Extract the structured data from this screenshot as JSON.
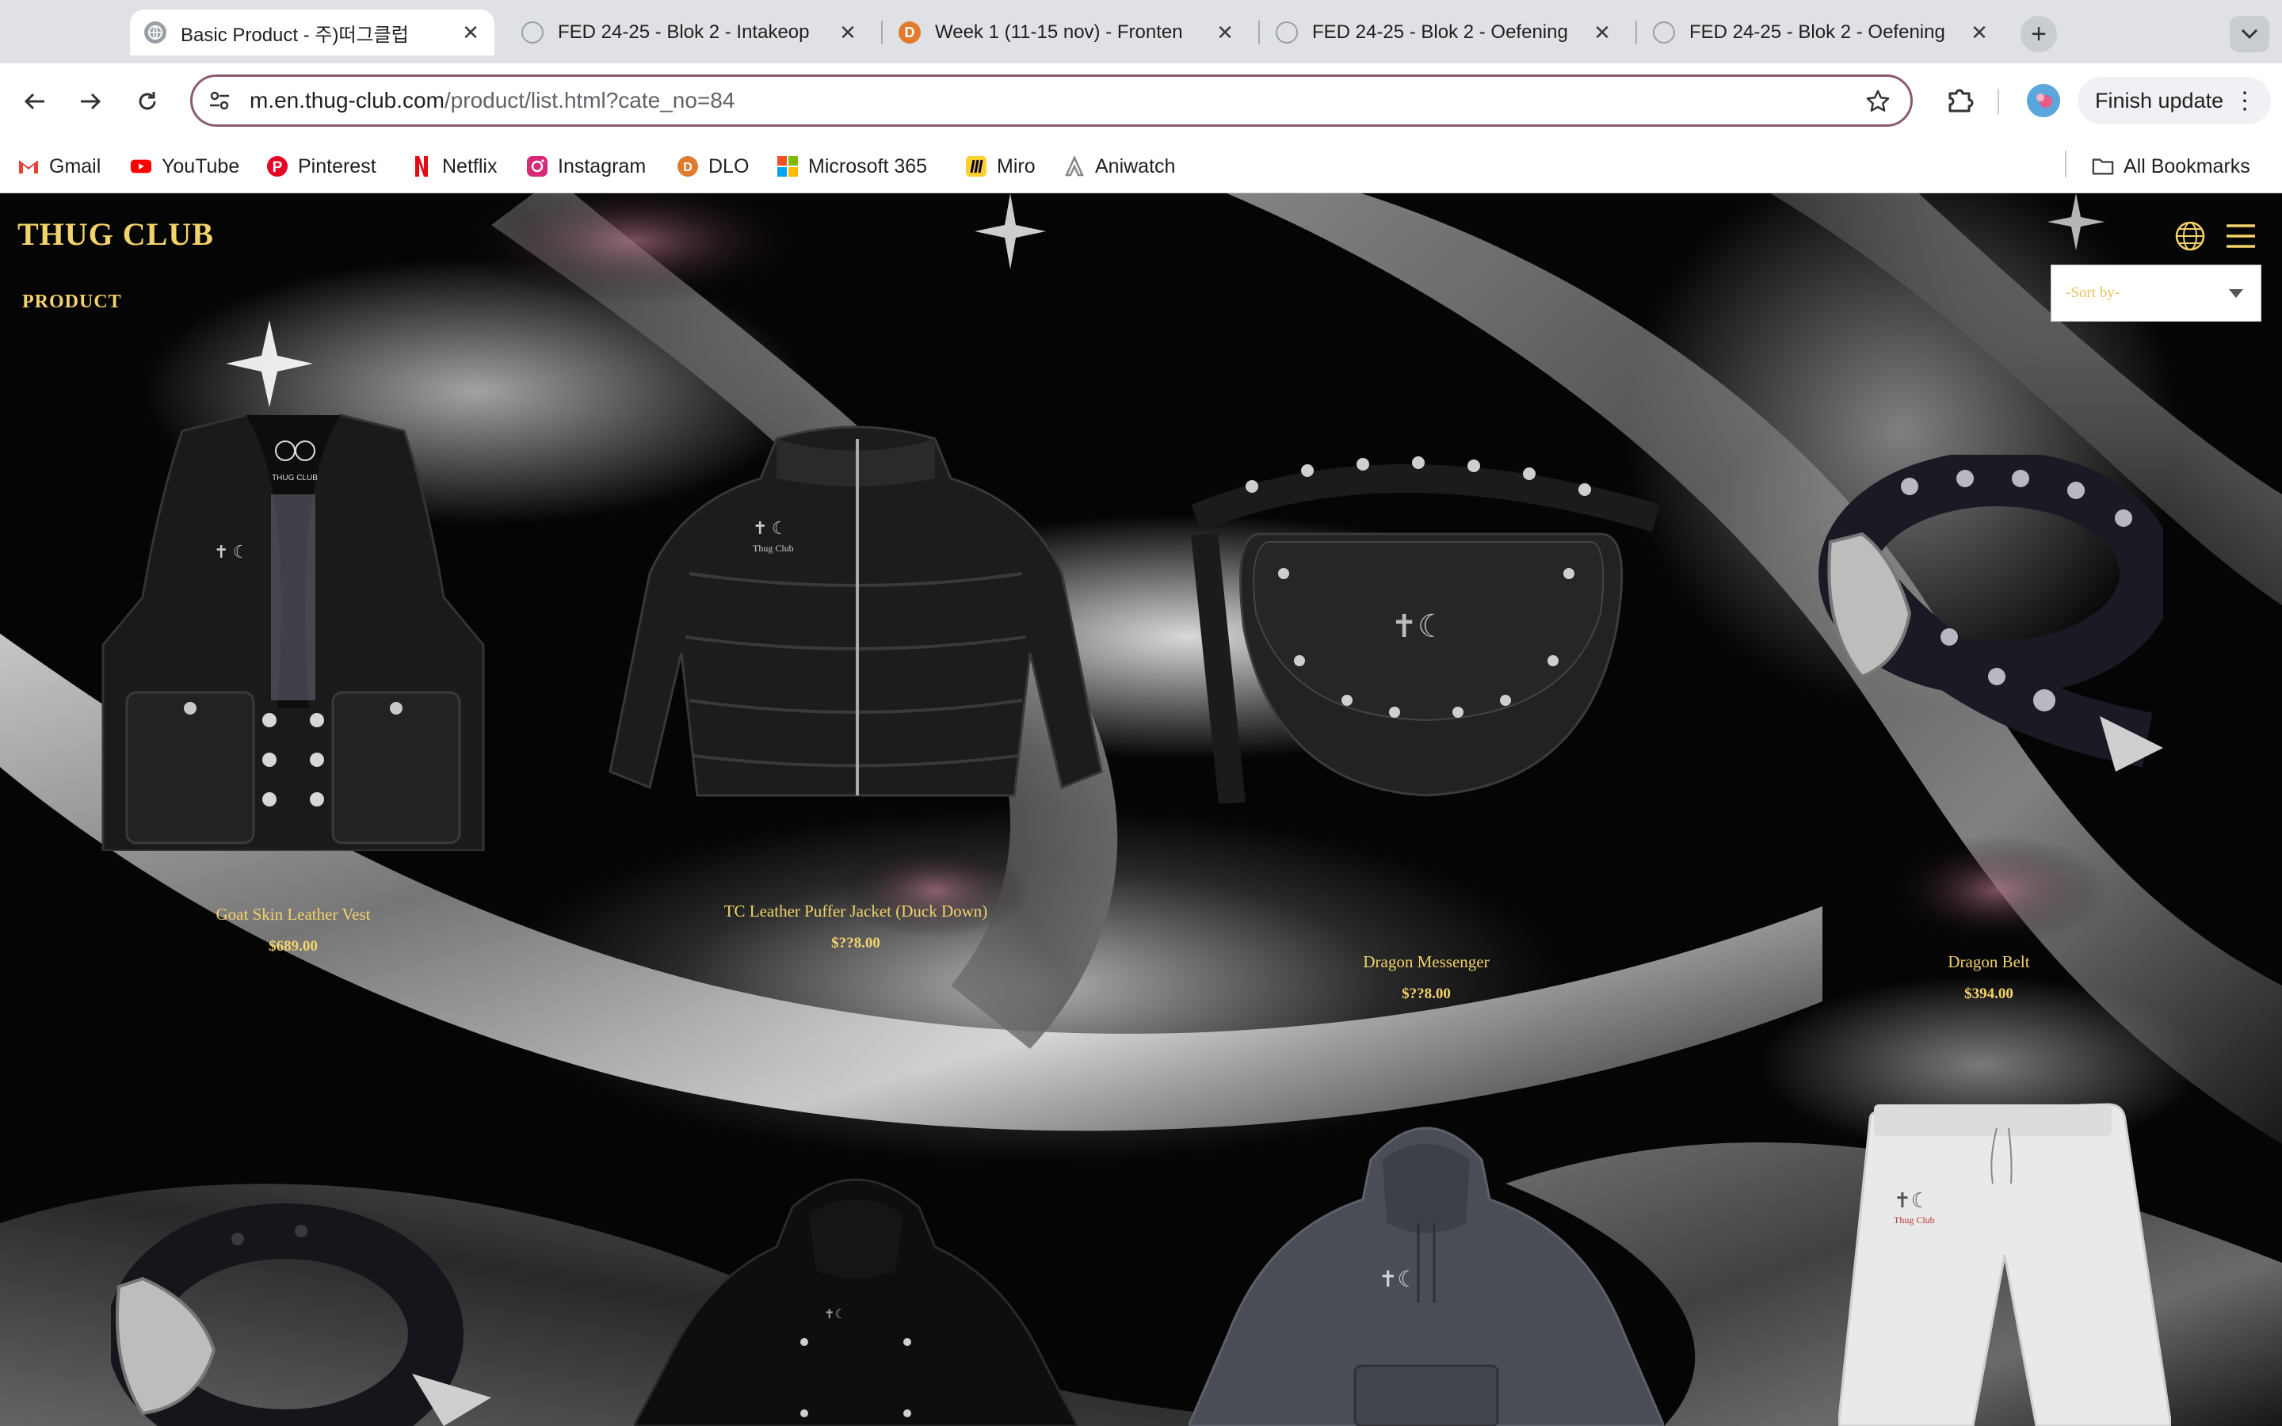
{
  "browser": {
    "tabs": [
      {
        "title": "Basic Product - 주)떠그클럽",
        "active": true
      },
      {
        "title": "FED 24-25 - Blok 2 - Intakeop",
        "active": false
      },
      {
        "title": "Week 1 (11-15 nov) - Fronten",
        "active": false
      },
      {
        "title": "FED 24-25 - Blok 2 - Oefening",
        "active": false
      },
      {
        "title": "FED 24-25 - Blok 2 - Oefening",
        "active": false
      }
    ],
    "url_host": "m.en.thug-club.com",
    "url_path": "/product/list.html?cate_no=84",
    "finish_update": "Finish update",
    "bookmarks": [
      {
        "label": "Gmail",
        "icon": "gmail-icon"
      },
      {
        "label": "YouTube",
        "icon": "youtube-icon"
      },
      {
        "label": "Pinterest",
        "icon": "pinterest-icon"
      },
      {
        "label": "Netflix",
        "icon": "netflix-icon"
      },
      {
        "label": "Instagram",
        "icon": "instagram-icon"
      },
      {
        "label": "DLO",
        "icon": "dlo-icon"
      },
      {
        "label": "Microsoft 365",
        "icon": "microsoft-icon"
      },
      {
        "label": "Miro",
        "icon": "miro-icon"
      },
      {
        "label": "Aniwatch",
        "icon": "aniwatch-icon"
      }
    ],
    "all_bookmarks": "All Bookmarks"
  },
  "site": {
    "brand": "THUG CLUB",
    "breadcrumb": "PRODUCT",
    "sort_placeholder": "-Sort by-",
    "accent_color": "#f3d36b",
    "products": [
      {
        "name": "Goat Skin Leather Vest",
        "price": "$689.00",
        "image": "leather-vest"
      },
      {
        "name": "TC Leather Puffer Jacket (Duck Down)",
        "price": "$??8.00",
        "image": "leather-puffer-jacket"
      },
      {
        "name": "Dragon Messenger",
        "price": "$??8.00",
        "image": "messenger-bag"
      },
      {
        "name": "Dragon Belt",
        "price": "$394.00",
        "image": "belt"
      },
      {
        "name": "",
        "price": "",
        "image": "belt-2"
      },
      {
        "name": "",
        "price": "",
        "image": "black-hoodie"
      },
      {
        "name": "",
        "price": "",
        "image": "grey-hoodie"
      },
      {
        "name": "",
        "price": "",
        "image": "white-sweatpants"
      }
    ]
  }
}
